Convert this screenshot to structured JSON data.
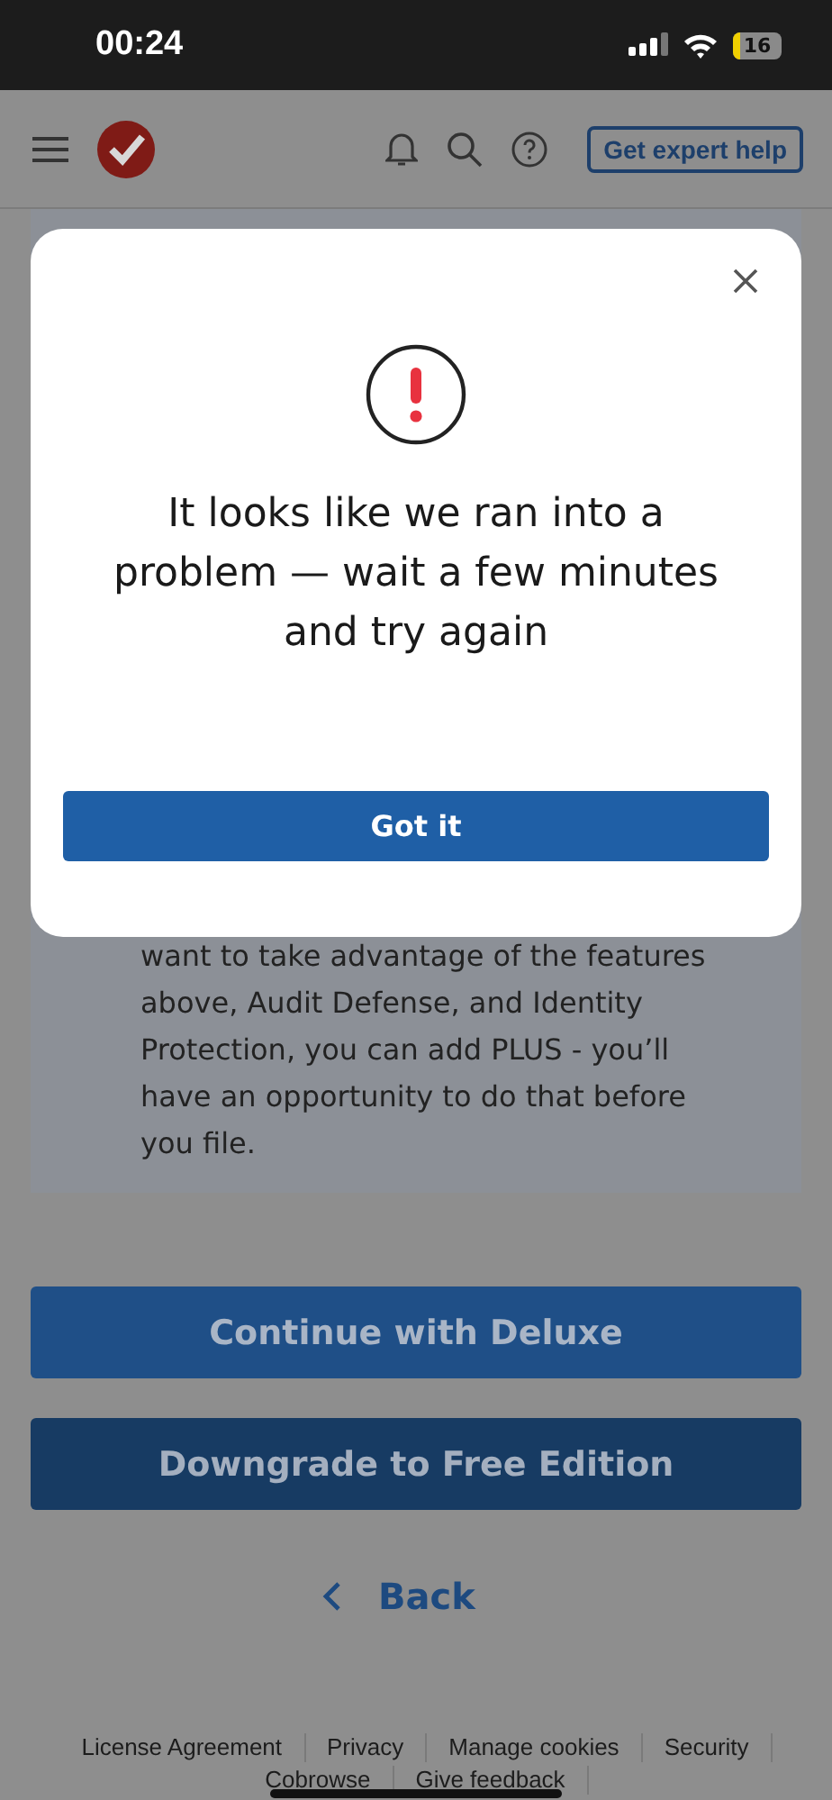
{
  "status_bar": {
    "time": "00:24",
    "battery": "16"
  },
  "header": {
    "expert_button": "Get expert help"
  },
  "panel": {
    "lines": [
      "want to take advantage of the features",
      "above, Audit Defense, and Identity",
      "Protection, you can add PLUS - you’ll",
      "have an opportunity to do that before",
      "you file."
    ]
  },
  "buttons": [
    {
      "label": "Continue with Deluxe",
      "kind": "primary"
    },
    {
      "label": "Downgrade to Free Edition",
      "kind": "secondary"
    }
  ],
  "back": {
    "label": "Back"
  },
  "footer": {
    "links": [
      "License Agreement",
      "Privacy",
      "Manage cookies",
      "Security"
    ],
    "links_2": [
      "Cobrowse",
      "Give feedback"
    ]
  },
  "dialog": {
    "message": "It looks like we ran into a problem — wait a few minutes and try again",
    "button": "Got it"
  }
}
